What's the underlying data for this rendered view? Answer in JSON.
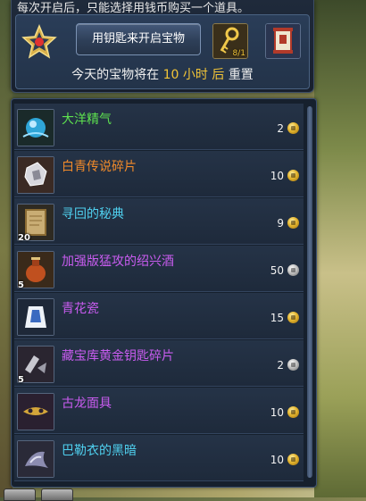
{
  "notice": "每次开启后，只能选择用钱币购买一个道具。",
  "key_button_label": "用钥匙来开启宝物",
  "reset_text": {
    "prefix": "今天的宝物将在",
    "number": "10",
    "unit": "小时",
    "after": "后",
    "suffix": "重置"
  },
  "slots": {
    "key_count": "8/1"
  },
  "items": [
    {
      "name": "大洋精气",
      "name_color": "#5ee24f",
      "price": "2",
      "currency": "gold",
      "qty": ""
    },
    {
      "name": "白青传说碎片",
      "name_color": "#f08a2a",
      "price": "10",
      "currency": "gold",
      "qty": ""
    },
    {
      "name": "寻回的秘典",
      "name_color": "#4fd0ef",
      "price": "9",
      "currency": "gold",
      "qty": "20"
    },
    {
      "name": "加强版猛攻的绍兴酒",
      "name_color": "#c95cf0",
      "price": "50",
      "currency": "silver",
      "qty": "5"
    },
    {
      "name": "青花瓷",
      "name_color": "#c95cf0",
      "price": "15",
      "currency": "gold",
      "qty": ""
    },
    {
      "name": "藏宝库黄金钥匙碎片",
      "name_color": "#c95cf0",
      "price": "2",
      "currency": "silver",
      "qty": "5"
    },
    {
      "name": "古龙面具",
      "name_color": "#c95cf0",
      "price": "10",
      "currency": "gold",
      "qty": ""
    },
    {
      "name": "巴勒衣的黑暗",
      "name_color": "#4fd0ef",
      "price": "10",
      "currency": "gold",
      "qty": ""
    }
  ],
  "colors": {
    "highlight": "#f3c537",
    "panel": "#1f2a3b"
  }
}
